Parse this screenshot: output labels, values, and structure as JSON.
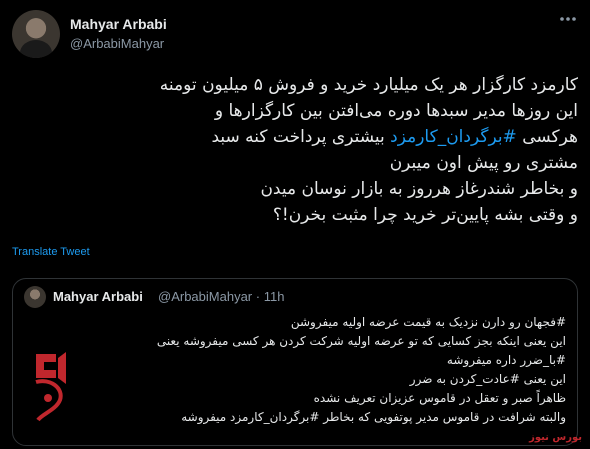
{
  "tweet": {
    "author_name": "Mahyar Arbabi",
    "author_handle": "@ArbabiMahyar",
    "more_icon": "more-options-icon",
    "lines": [
      {
        "before": "کارمزد کارگزار هر یک میلیارد خرید و فروش ۵ میلیون تومنه",
        "tag": "",
        "after": ""
      },
      {
        "before": "این روزها مدیر سبدها دوره می‌افتن بین کارگزارها و",
        "tag": "",
        "after": ""
      },
      {
        "before": "هرکسی ",
        "tag": "#برگردان_کارمزد",
        "after": " بیشتری پرداخت کنه سبد"
      },
      {
        "before": "مشتری رو پیش اون میبرن",
        "tag": "",
        "after": ""
      },
      {
        "before": "و بخاطر شندرغاز هرروز به بازار نوسان میدن",
        "tag": "",
        "after": ""
      },
      {
        "before": "و وقتی بشه پایین‌تر خرید چرا مثبت بخرن!؟",
        "tag": "",
        "after": ""
      }
    ],
    "translate_label": "Translate Tweet"
  },
  "quoted": {
    "author_name": "Mahyar Arbabi",
    "author_handle": "@ArbabiMahyar",
    "separator": "·",
    "time": "11h",
    "lines": [
      "#فجهان رو دارن نزدیک به قیمت عرضه اولیه میفروشن",
      "این یعنی اینکه بجز کسایی که تو عرضه اولیه شرکت کردن هر کسی میفروشه یعنی",
      "#با_ضرر داره میفروشه",
      "این یعنی #عادت_کردن به ضرر",
      "ظاهراً صبر و تعقل در قاموس عزیزان تعریف نشده",
      "والبته شرافت در قاموس مدیر پوتفویی که بخاطر #برگردان_کارمزد میفروشه"
    ]
  },
  "logo_text": "بورس نیوز",
  "watermark": "بورس نیوز",
  "colors": {
    "background": "#000000",
    "text": "#e7e9ea",
    "muted": "#8b98a5",
    "link": "#1d9bf0",
    "border": "#2f3336",
    "brand_red": "#c0272d"
  }
}
